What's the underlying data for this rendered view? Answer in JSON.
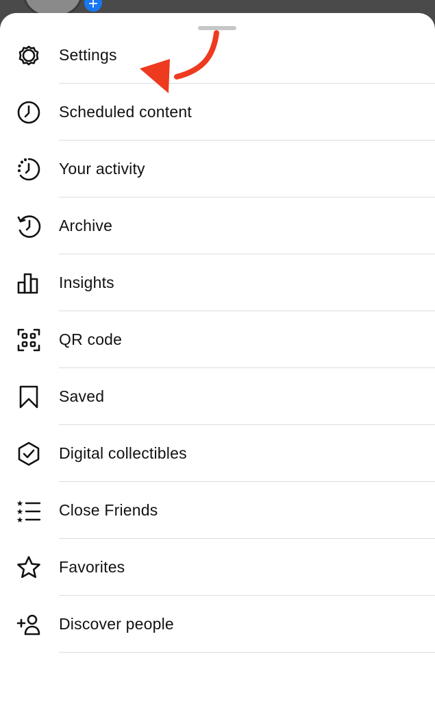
{
  "colors": {
    "arrow": "#ee3a1f",
    "text": "#111111",
    "divider": "#dcdcdc",
    "plus_badge": "#1877f2"
  },
  "avatar_badge": "+",
  "menu": {
    "items": [
      {
        "label": "Settings",
        "icon": "gear-icon"
      },
      {
        "label": "Scheduled content",
        "icon": "clock-icon"
      },
      {
        "label": "Your activity",
        "icon": "activity-icon"
      },
      {
        "label": "Archive",
        "icon": "archive-icon"
      },
      {
        "label": "Insights",
        "icon": "insights-icon"
      },
      {
        "label": "QR code",
        "icon": "qr-code-icon"
      },
      {
        "label": "Saved",
        "icon": "bookmark-icon"
      },
      {
        "label": "Digital collectibles",
        "icon": "collectibles-icon"
      },
      {
        "label": "Close Friends",
        "icon": "close-friends-icon"
      },
      {
        "label": "Favorites",
        "icon": "star-icon"
      },
      {
        "label": "Discover people",
        "icon": "add-person-icon"
      }
    ]
  }
}
